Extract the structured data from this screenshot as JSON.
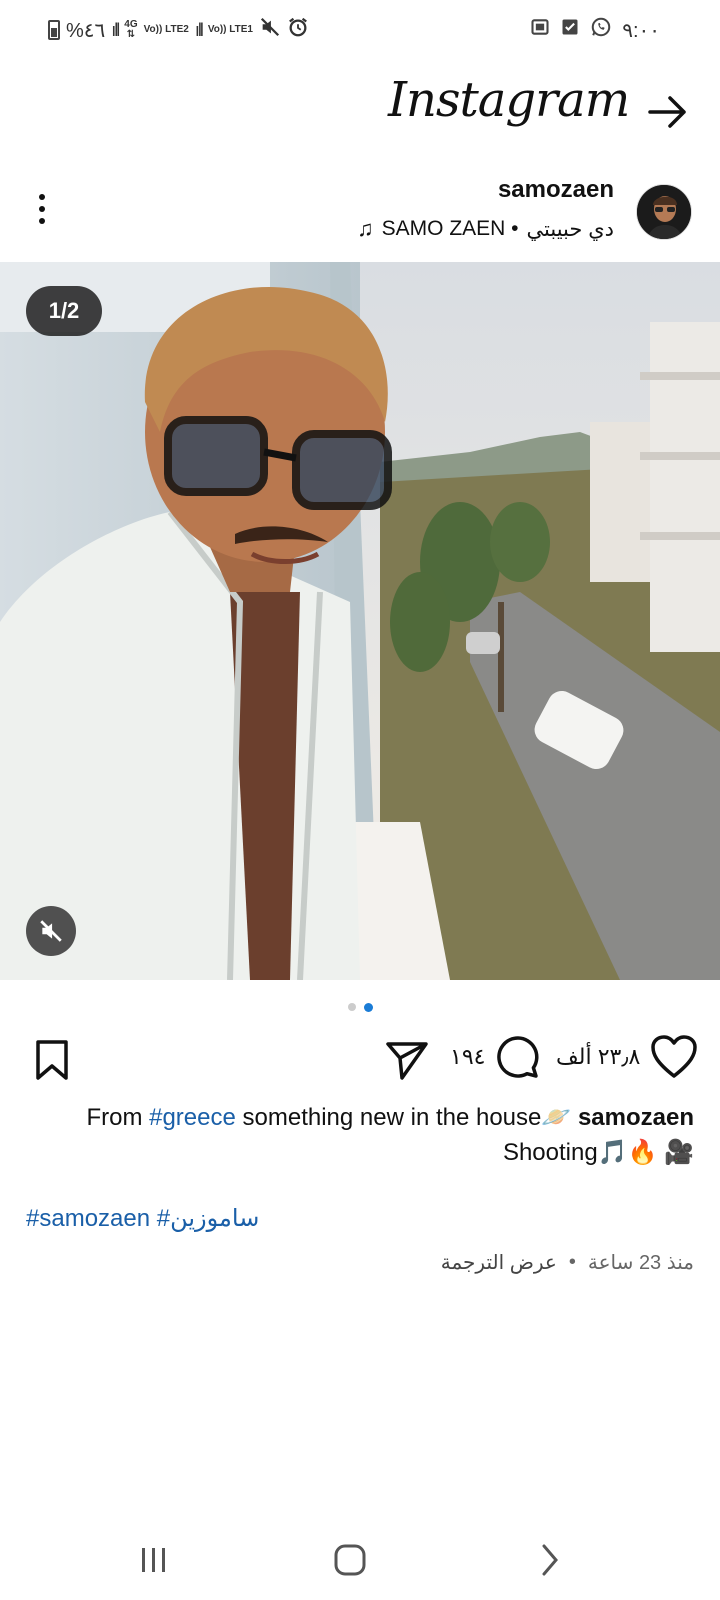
{
  "status_bar": {
    "time": "٩:٠٠",
    "battery": "%٤٦",
    "network1": "4G",
    "lte1": "Vo)) LTE2",
    "lte2": "Vo)) LTE1"
  },
  "header": {
    "logo": "Instagram"
  },
  "post": {
    "username": "samozaen",
    "audio_artist": "SAMO ZAEN •",
    "audio_track": "دي حبيبتي",
    "image_counter": "1/2",
    "carousel_total": 2,
    "carousel_active": 2
  },
  "actions": {
    "likes": "٢٣٫٨ ألف",
    "comments": "١٩٤"
  },
  "caption": {
    "username": "samozaen",
    "text_part1": " something new in the house",
    "hashtag1": "#greece",
    "from": "From ",
    "emoji1": "🪐",
    "line2": "Shooting🎵🔥 🎥",
    "tags": "#samozaen #ساموزين"
  },
  "meta": {
    "time_ago": "منذ 23 ساعة",
    "separator": "•",
    "see_translation": "عرض الترجمة"
  },
  "colors": {
    "link": "#1a5fa8",
    "dot_active": "#1a7cd6"
  }
}
